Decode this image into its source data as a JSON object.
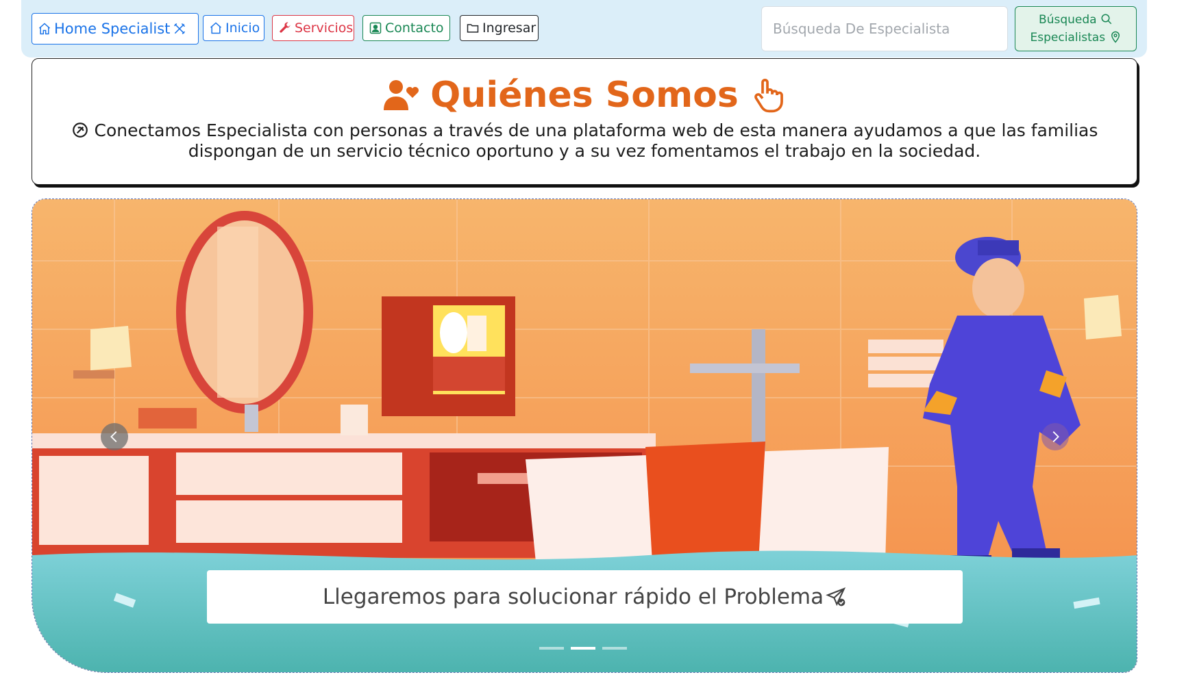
{
  "navbar": {
    "brand_label": "Home Specialist",
    "items": [
      {
        "label": "Inicio"
      },
      {
        "label": "Servicios"
      },
      {
        "label": "Contacto"
      },
      {
        "label": "Ingresar"
      }
    ],
    "search": {
      "placeholder": "Búsqueda De Especialista",
      "value": ""
    },
    "search_button": {
      "line1": "Búsqueda",
      "line2": "Especialistas"
    }
  },
  "about": {
    "title": "Quiénes Somos",
    "text": "Conectamos Especialista con personas a través de una plataforma web de esta manera ayudamos a que las familias dispongan de un servicio técnico oportuno y a su vez fomentamos el trabajo en la sociedad."
  },
  "carousel": {
    "caption": "Llegaremos para solucionar rápido el Problema",
    "active_slide": 2,
    "slide_count": 3
  },
  "colors": {
    "primary": "#1a73e8",
    "danger": "#dc3545",
    "success": "#198754",
    "accent_orange": "#e2661a",
    "navbar_bg": "#dbeef9"
  },
  "icons": [
    "house-icon",
    "tools-icon",
    "wrench-icon",
    "person-badge-icon",
    "folder-icon",
    "search-icon",
    "geo-pin-icon",
    "users-heart-icon",
    "hand-pointer-icon",
    "circle-icon",
    "send-check-icon",
    "chevron-left-icon",
    "chevron-right-icon"
  ]
}
